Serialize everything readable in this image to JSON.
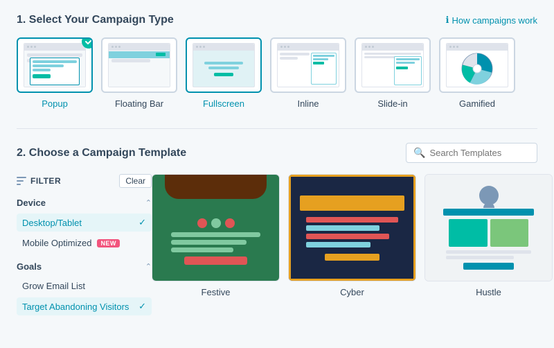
{
  "section1": {
    "title": "1. Select Your Campaign Type",
    "help_link": "How campaigns work",
    "campaign_types": [
      {
        "id": "popup",
        "label": "Popup",
        "selected": true
      },
      {
        "id": "floating-bar",
        "label": "Floating Bar",
        "selected": false
      },
      {
        "id": "fullscreen",
        "label": "Fullscreen",
        "selected": false,
        "active_text": true
      },
      {
        "id": "inline",
        "label": "Inline",
        "selected": false
      },
      {
        "id": "slide-in",
        "label": "Slide-in",
        "selected": false
      },
      {
        "id": "gamified",
        "label": "Gamified",
        "selected": false
      }
    ]
  },
  "section2": {
    "title": "2. Choose a Campaign Template",
    "search_placeholder": "Search Templates"
  },
  "filter": {
    "label": "FILTER",
    "clear_label": "Clear",
    "sections": [
      {
        "title": "Device",
        "expanded": true,
        "options": [
          {
            "label": "Desktop/Tablet",
            "selected": true
          },
          {
            "label": "Mobile Optimized",
            "selected": false,
            "badge": "NEW"
          }
        ]
      },
      {
        "title": "Goals",
        "expanded": true,
        "options": [
          {
            "label": "Grow Email List",
            "selected": false
          },
          {
            "label": "Target Abandoning Visitors",
            "selected": true
          }
        ]
      }
    ]
  },
  "templates": [
    {
      "name": "Festive"
    },
    {
      "name": "Cyber"
    },
    {
      "name": "Hustle"
    }
  ],
  "colors": {
    "brand_blue": "#0091ae",
    "teal": "#00bda5",
    "red": "#f2547d",
    "text": "#33475b",
    "border": "#cbd6e2"
  }
}
